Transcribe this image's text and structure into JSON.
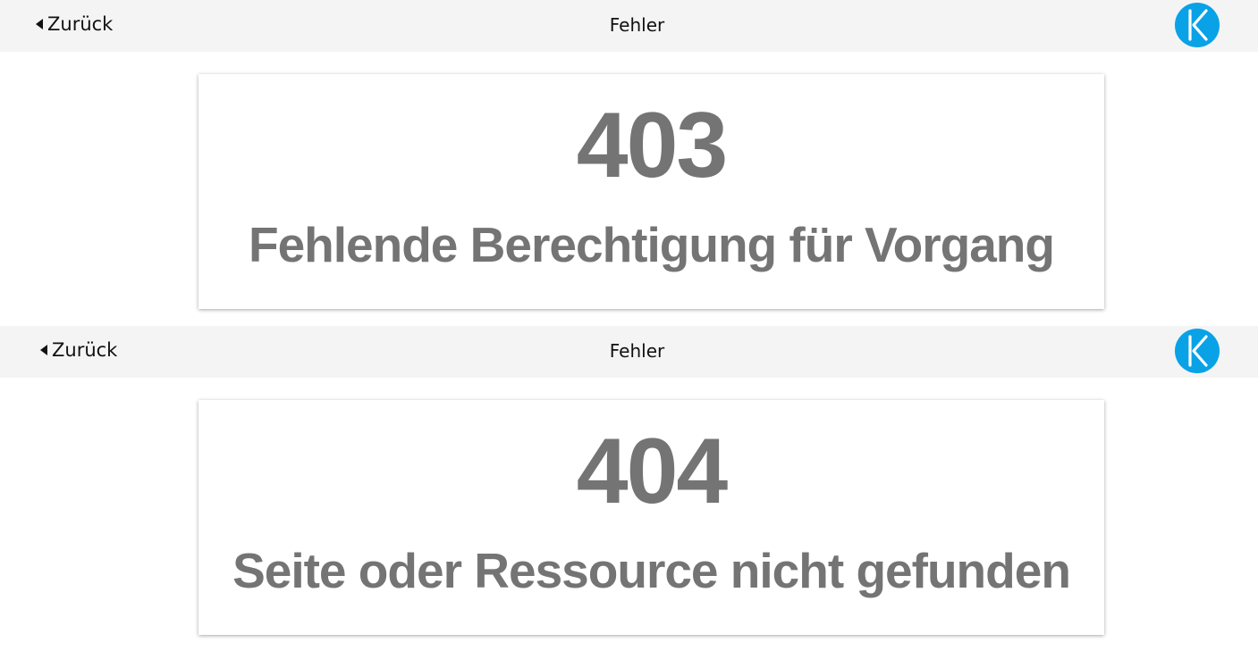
{
  "screens": [
    {
      "header": {
        "back_label": "Zurück",
        "title": "Fehler",
        "logo_letter": "K"
      },
      "error": {
        "code": "403",
        "message": "Fehlende Berechtigung für Vorgang"
      }
    },
    {
      "header": {
        "back_label": "Zurück",
        "title": "Fehler",
        "logo_letter": "K"
      },
      "error": {
        "code": "404",
        "message": "Seite oder Ressource nicht gefunden"
      }
    }
  ],
  "colors": {
    "header_background": "#f4f4f4",
    "logo_background": "#09a2e7",
    "error_text": "#747474"
  },
  "icons": {
    "back": "caret-left-icon",
    "logo": "k-logo-icon"
  }
}
